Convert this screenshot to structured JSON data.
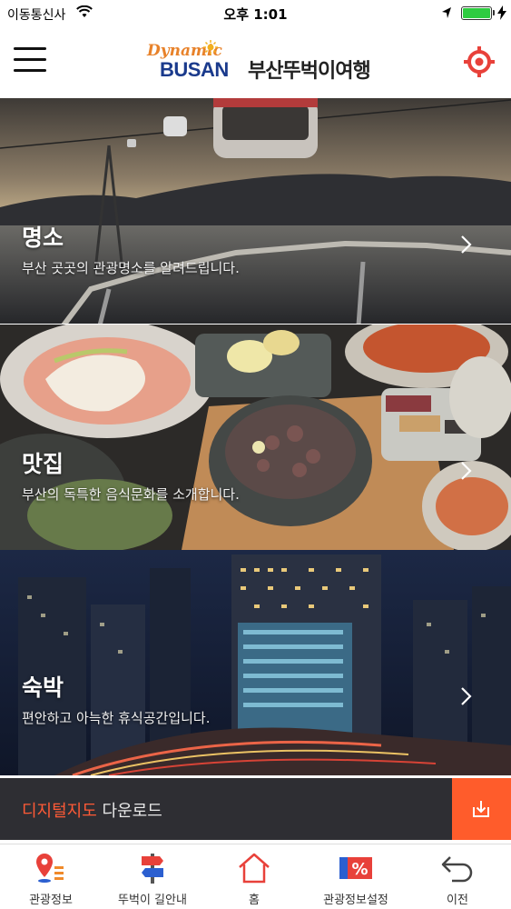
{
  "status_bar": {
    "carrier": "이동통신사",
    "time": "오후 1:01",
    "battery_level": 1.0
  },
  "header": {
    "logo_dynamic": "Dynamic",
    "logo_busan": "BUSAN",
    "app_title": "부산뚜벅이여행",
    "menu_icon": "hamburger-menu-icon",
    "location_icon": "target-location-icon"
  },
  "categories": [
    {
      "label": "명소",
      "description": "부산 곳곳의 관광명소를 알려드립니다."
    },
    {
      "label": "맛집",
      "description": "부산의 독특한 음식문화를 소개합니다."
    },
    {
      "label": "숙박",
      "description": "편안하고 아늑한 휴식공간입니다."
    }
  ],
  "download": {
    "highlight": "디지털지도",
    "text": " 다운로드",
    "icon": "download-icon"
  },
  "tabs": [
    {
      "label": "관광정보",
      "icon": "map-pin-list-icon"
    },
    {
      "label": "뚜벅이 길안내",
      "icon": "signpost-icon"
    },
    {
      "label": "홈",
      "icon": "home-icon"
    },
    {
      "label": "관광정보설정",
      "icon": "percent-settings-icon"
    },
    {
      "label": "이전",
      "icon": "back-arrow-icon"
    }
  ],
  "colors": {
    "accent": "#ff5c2b",
    "brand_orange": "#e8822a",
    "brand_blue": "#1a3a8c",
    "icon_red": "#e8413a",
    "icon_blue": "#2b5fd0"
  }
}
